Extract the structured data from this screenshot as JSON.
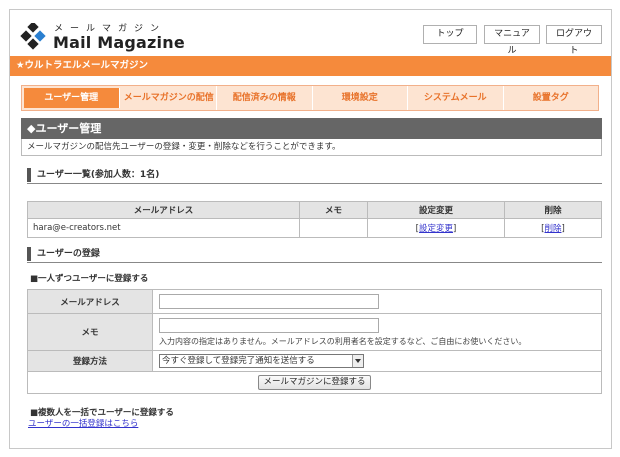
{
  "header": {
    "logo_kana": "メールマガジン",
    "logo_text": "Mail Magazine",
    "buttons": [
      "トップ",
      "マニュアル",
      "ログアウト"
    ]
  },
  "banner": "★ウルトラエルメールマガジン",
  "tabs": [
    {
      "label": "ユーザー管理",
      "active": true
    },
    {
      "label": "メールマガジンの配信",
      "active": false
    },
    {
      "label": "配信済みの情報",
      "active": false
    },
    {
      "label": "環境設定",
      "active": false
    },
    {
      "label": "システムメール",
      "active": false
    },
    {
      "label": "設置タグ",
      "active": false
    }
  ],
  "section": {
    "title": "◆ユーザー管理",
    "description": "メールマガジンの配信先ユーザーの登録・変更・削除などを行うことができます。"
  },
  "user_list": {
    "heading": "ユーザー一覧(参加人数：1名)",
    "columns": [
      "メールアドレス",
      "メモ",
      "設定変更",
      "削除"
    ],
    "rows": [
      {
        "email": "hara@e-creators.net",
        "memo": "",
        "edit": "設定変更",
        "delete": "削除"
      }
    ]
  },
  "register": {
    "heading": "ユーザーの登録",
    "single_heading": "■一人ずつユーザーに登録する",
    "email_label": "メールアドレス",
    "email_value": "",
    "memo_label": "メモ",
    "memo_value": "",
    "memo_hint": "入力内容の指定はありません。メールアドレスの利用者名を設定するなど、ご自由にお使いください。",
    "method_label": "登録方法",
    "method_selected": "今すぐ登録して登録完了通知を送信する",
    "submit_label": "メールマガジンに登録する",
    "bulk_heading": "■複数人を一括でユーザーに登録する",
    "bulk_link": "ユーザーの一括登録はこちら"
  },
  "colors": {
    "accent": "#f58a3c",
    "tab_bg": "#fde4d2",
    "section_head": "#666666",
    "link": "#3333cc"
  }
}
